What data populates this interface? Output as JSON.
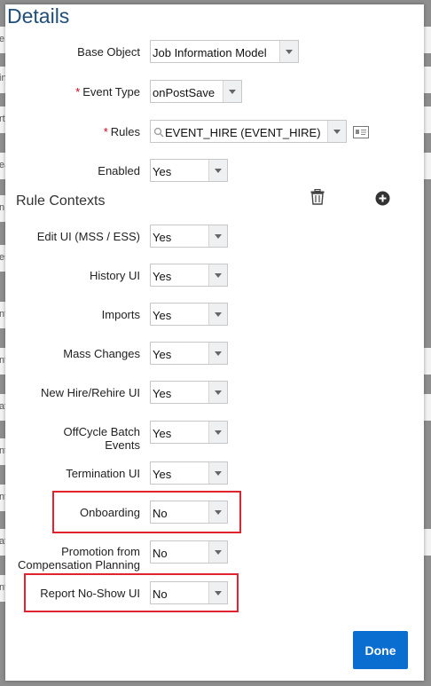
{
  "dialog": {
    "title": "Details"
  },
  "fields": {
    "base_object": {
      "label": "Base Object",
      "value": "Job Information Model"
    },
    "event_type": {
      "required_mark": "*",
      "label": "Event Type",
      "value": "onPostSave"
    },
    "rules": {
      "required_mark": "*",
      "label": "Rules",
      "value": "EVENT_HIRE (EVENT_HIRE)"
    },
    "enabled": {
      "label": "Enabled",
      "value": "Yes"
    }
  },
  "rule_contexts": {
    "title": "Rule Contexts",
    "items": [
      {
        "label": "Edit UI (MSS / ESS)",
        "value": "Yes"
      },
      {
        "label": "History UI",
        "value": "Yes"
      },
      {
        "label": "Imports",
        "value": "Yes"
      },
      {
        "label": "Mass Changes",
        "value": "Yes"
      },
      {
        "label": "New Hire/Rehire UI",
        "value": "Yes"
      },
      {
        "label": "OffCycle Batch Events",
        "value": "Yes"
      },
      {
        "label": "Termination UI",
        "value": "Yes"
      },
      {
        "label": "Onboarding",
        "value": "No"
      },
      {
        "label": "Promotion from Compensation Planning",
        "value": "No"
      },
      {
        "label": "Report No-Show UI",
        "value": "No"
      }
    ]
  },
  "actions": {
    "done_label": "Done"
  },
  "icons": {
    "delete": "trash-icon",
    "add": "plus-circle-icon",
    "details": "details-card-icon",
    "search": "search-icon"
  },
  "colors": {
    "title": "#1f4e79",
    "done_bg": "#0a6ed1",
    "highlight": "#e0232e",
    "required": "#d0001b"
  }
}
